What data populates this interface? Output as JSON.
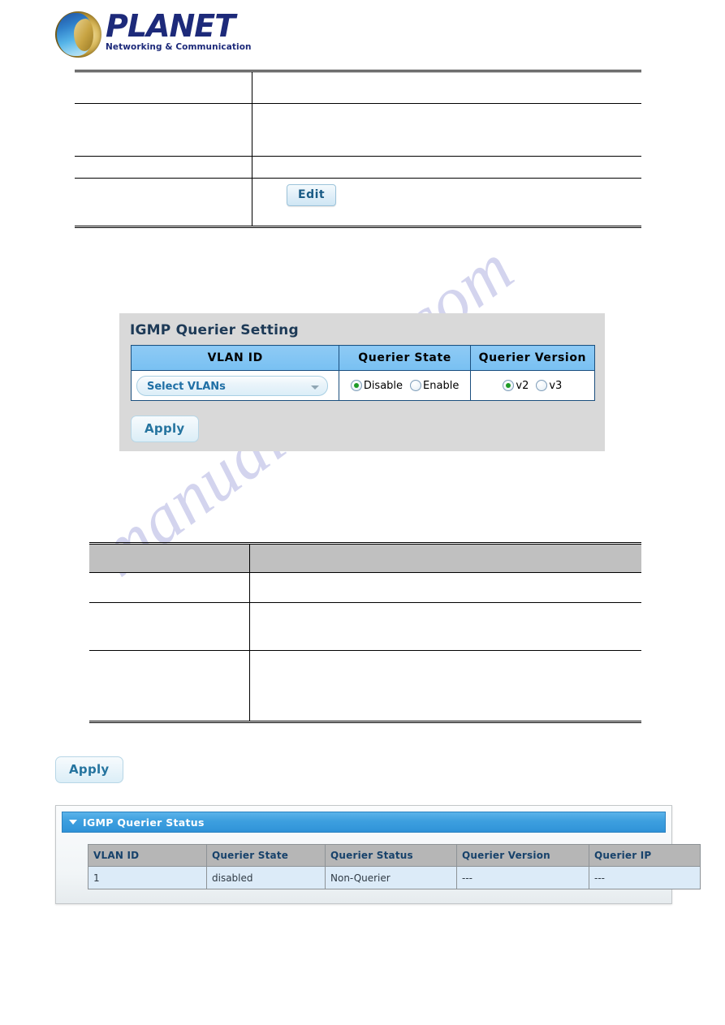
{
  "brand": {
    "name": "PLANET",
    "tagline": "Networking & Communication",
    "logo_icon": "planet-globe-icon",
    "wordmark_color": "#1d2a7a"
  },
  "watermark": {
    "text": "manualshive.com",
    "color": "#b9bbe4"
  },
  "top_table": {
    "rows": [
      {
        "label": "",
        "description": ""
      },
      {
        "label": "",
        "description": ""
      },
      {
        "label": "",
        "description": ""
      },
      {
        "label": "",
        "description": ""
      }
    ],
    "edit_button": "Edit"
  },
  "querier_setting": {
    "title": "IGMP Querier Setting",
    "columns": [
      "VLAN ID",
      "Querier State",
      "Querier Version"
    ],
    "vlan_select": {
      "value": "Select VLANs",
      "caret_icon": "chevron-down-icon"
    },
    "querier_state": {
      "options": [
        "Disable",
        "Enable"
      ],
      "selected": "Disable"
    },
    "querier_version": {
      "options": [
        "v2",
        "v3"
      ],
      "selected": "v2"
    },
    "apply_label": "Apply",
    "panel_bg": "#d9d9d9",
    "header_color": "#78c0f2",
    "radio_on_color": "#1f9b26"
  },
  "mid_table": {
    "header": {
      "col1": "",
      "col2": ""
    },
    "rows": [
      {
        "label": "",
        "description": ""
      },
      {
        "label": "",
        "description": ""
      },
      {
        "label": "",
        "description": ""
      }
    ]
  },
  "standalone_apply": {
    "label": "Apply"
  },
  "querier_status": {
    "header_title": "IGMP Querier Status",
    "collapse_icon": "triangle-down-icon",
    "columns": [
      "VLAN ID",
      "Querier State",
      "Querier Status",
      "Querier Version",
      "Querier IP"
    ],
    "rows": [
      [
        "1",
        "disabled",
        "Non-Querier",
        "---",
        "---"
      ]
    ],
    "header_bg": "#3d9fdf",
    "table_header_bg": "#b6b6b6",
    "row_bg": "#dcebf8"
  }
}
